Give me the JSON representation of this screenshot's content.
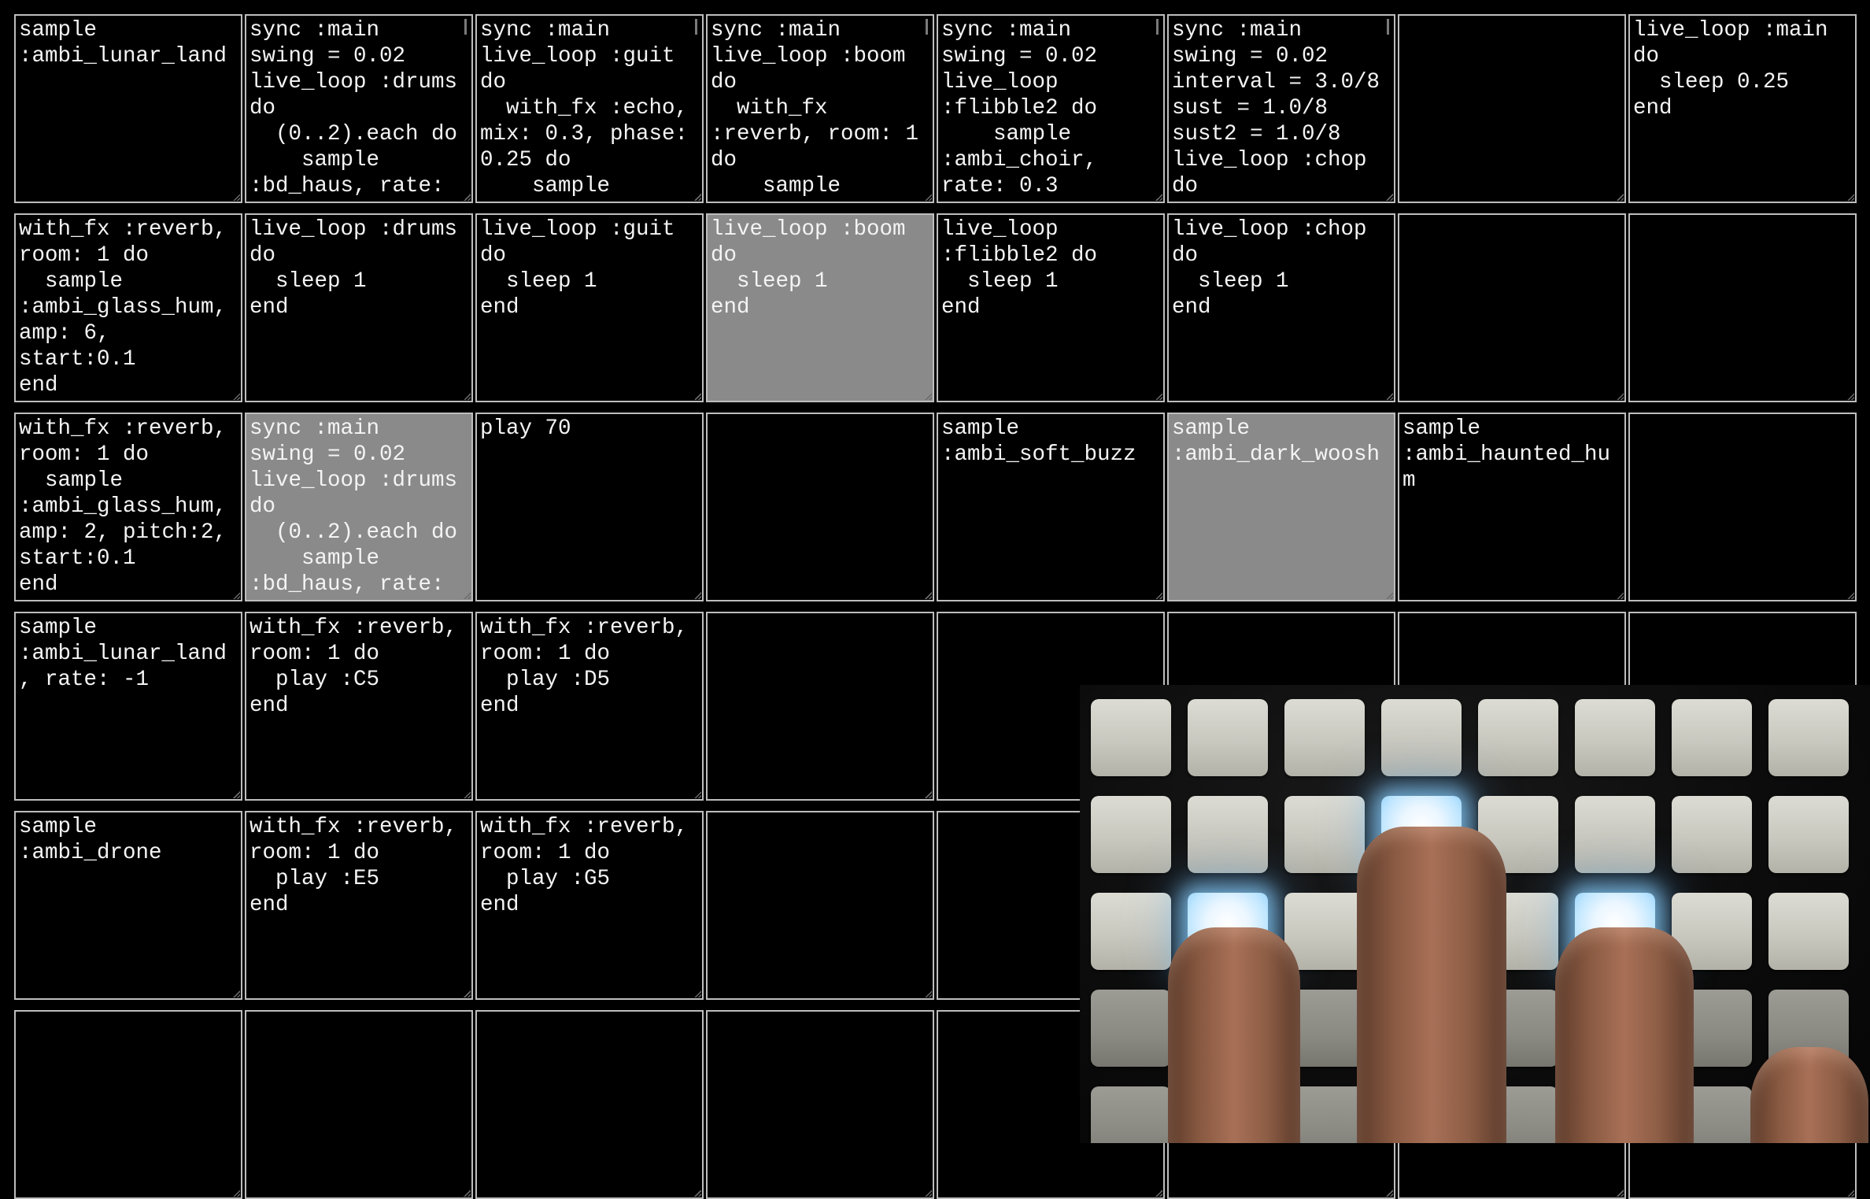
{
  "grid": {
    "cells": [
      [
        {
          "code": "sample\n:ambi_lunar_land",
          "active": false,
          "scroll": false
        },
        {
          "code": "sync :main\nswing = 0.02\nlive_loop :drums\ndo\n  (0..2).each do\n    sample\n:bd_haus, rate:",
          "active": false,
          "scroll": true
        },
        {
          "code": "sync :main\nlive_loop :guit\ndo\n  with_fx :echo,\nmix: 0.3, phase:\n0.25 do\n    sample",
          "active": false,
          "scroll": true
        },
        {
          "code": "sync :main\nlive_loop :boom\ndo\n  with_fx\n:reverb, room: 1\ndo\n    sample",
          "active": false,
          "scroll": true
        },
        {
          "code": "sync :main\nswing = 0.02\nlive_loop\n:flibble2 do\n    sample\n:ambi_choir,\nrate: 0.3",
          "active": false,
          "scroll": true
        },
        {
          "code": "sync :main\nswing = 0.02\ninterval = 3.0/8\nsust = 1.0/8\nsust2 = 1.0/8\nlive_loop :chop\ndo",
          "active": false,
          "scroll": true
        },
        {
          "code": "",
          "active": false,
          "scroll": false
        },
        {
          "code": "live_loop :main\ndo\n  sleep 0.25\nend",
          "active": false,
          "scroll": false
        }
      ],
      [
        {
          "code": "with_fx :reverb,\nroom: 1 do\n  sample\n:ambi_glass_hum,\namp: 6,\nstart:0.1\nend",
          "active": false,
          "scroll": false
        },
        {
          "code": "live_loop :drums\ndo\n  sleep 1\nend",
          "active": false,
          "scroll": false
        },
        {
          "code": "live_loop :guit\ndo\n  sleep 1\nend",
          "active": false,
          "scroll": false
        },
        {
          "code": "live_loop :boom\ndo\n  sleep 1\nend",
          "active": true,
          "scroll": false
        },
        {
          "code": "live_loop\n:flibble2 do\n  sleep 1\nend",
          "active": false,
          "scroll": false
        },
        {
          "code": "live_loop :chop\ndo\n  sleep 1\nend",
          "active": false,
          "scroll": false
        },
        {
          "code": "",
          "active": false,
          "scroll": false
        },
        {
          "code": "",
          "active": false,
          "scroll": false
        }
      ],
      [
        {
          "code": "with_fx :reverb,\nroom: 1 do\n  sample\n:ambi_glass_hum,\namp: 2, pitch:2,\nstart:0.1\nend",
          "active": false,
          "scroll": false
        },
        {
          "code": "sync :main\nswing = 0.02\nlive_loop :drums\ndo\n  (0..2).each do\n    sample\n:bd_haus, rate:",
          "active": true,
          "scroll": false
        },
        {
          "code": "play 70",
          "active": false,
          "scroll": false
        },
        {
          "code": "",
          "active": false,
          "scroll": false
        },
        {
          "code": "sample\n:ambi_soft_buzz",
          "active": false,
          "scroll": false
        },
        {
          "code": "sample\n:ambi_dark_woosh",
          "active": true,
          "scroll": false
        },
        {
          "code": "sample\n:ambi_haunted_hu\nm",
          "active": false,
          "scroll": false
        },
        {
          "code": "",
          "active": false,
          "scroll": false
        }
      ],
      [
        {
          "code": "sample\n:ambi_lunar_land\n, rate: -1",
          "active": false,
          "scroll": false
        },
        {
          "code": "with_fx :reverb,\nroom: 1 do\n  play :C5\nend",
          "active": false,
          "scroll": false
        },
        {
          "code": "with_fx :reverb,\nroom: 1 do\n  play :D5\nend",
          "active": false,
          "scroll": false
        },
        {
          "code": "",
          "active": false,
          "scroll": false
        },
        {
          "code": "",
          "active": false,
          "scroll": false
        },
        {
          "code": "",
          "active": false,
          "scroll": false
        },
        {
          "code": "",
          "active": false,
          "scroll": false
        },
        {
          "code": "",
          "active": false,
          "scroll": false
        }
      ],
      [
        {
          "code": "sample\n:ambi_drone",
          "active": false,
          "scroll": false
        },
        {
          "code": "with_fx :reverb,\nroom: 1 do\n  play :E5\nend",
          "active": false,
          "scroll": false
        },
        {
          "code": "with_fx :reverb,\nroom: 1 do\n  play :G5\nend",
          "active": false,
          "scroll": false
        },
        {
          "code": "",
          "active": false,
          "scroll": false
        },
        {
          "code": "",
          "active": false,
          "scroll": false
        },
        {
          "code": "",
          "active": false,
          "scroll": false
        },
        {
          "code": "",
          "active": false,
          "scroll": false
        },
        {
          "code": "",
          "active": false,
          "scroll": false
        }
      ],
      [
        {
          "code": "",
          "active": false,
          "scroll": false
        },
        {
          "code": "",
          "active": false,
          "scroll": false
        },
        {
          "code": "",
          "active": false,
          "scroll": false
        },
        {
          "code": "",
          "active": false,
          "scroll": false
        },
        {
          "code": "",
          "active": false,
          "scroll": false
        },
        {
          "code": "",
          "active": false,
          "scroll": false
        },
        {
          "code": "",
          "active": false,
          "scroll": false
        },
        {
          "code": "",
          "active": false,
          "scroll": false
        }
      ]
    ]
  },
  "launchpad": {
    "pads": [
      [
        "on",
        "on",
        "on",
        "on",
        "on",
        "on",
        "on",
        "on"
      ],
      [
        "on",
        "on",
        "on",
        "lit",
        "on",
        "on",
        "on",
        "on"
      ],
      [
        "on",
        "lit",
        "on",
        "on",
        "on",
        "lit",
        "on",
        "on"
      ],
      [
        "dim",
        "dim",
        "dim",
        "dim",
        "dim",
        "dim",
        "dim",
        "dim"
      ],
      [
        "dim",
        "dim",
        "dim",
        "dim",
        "dim",
        "dim",
        "dim",
        "dim"
      ]
    ],
    "colors": {
      "pad_on": "#cfcec5",
      "pad_dim": "#8a8982",
      "pad_lit": "#bfe6ff"
    }
  }
}
